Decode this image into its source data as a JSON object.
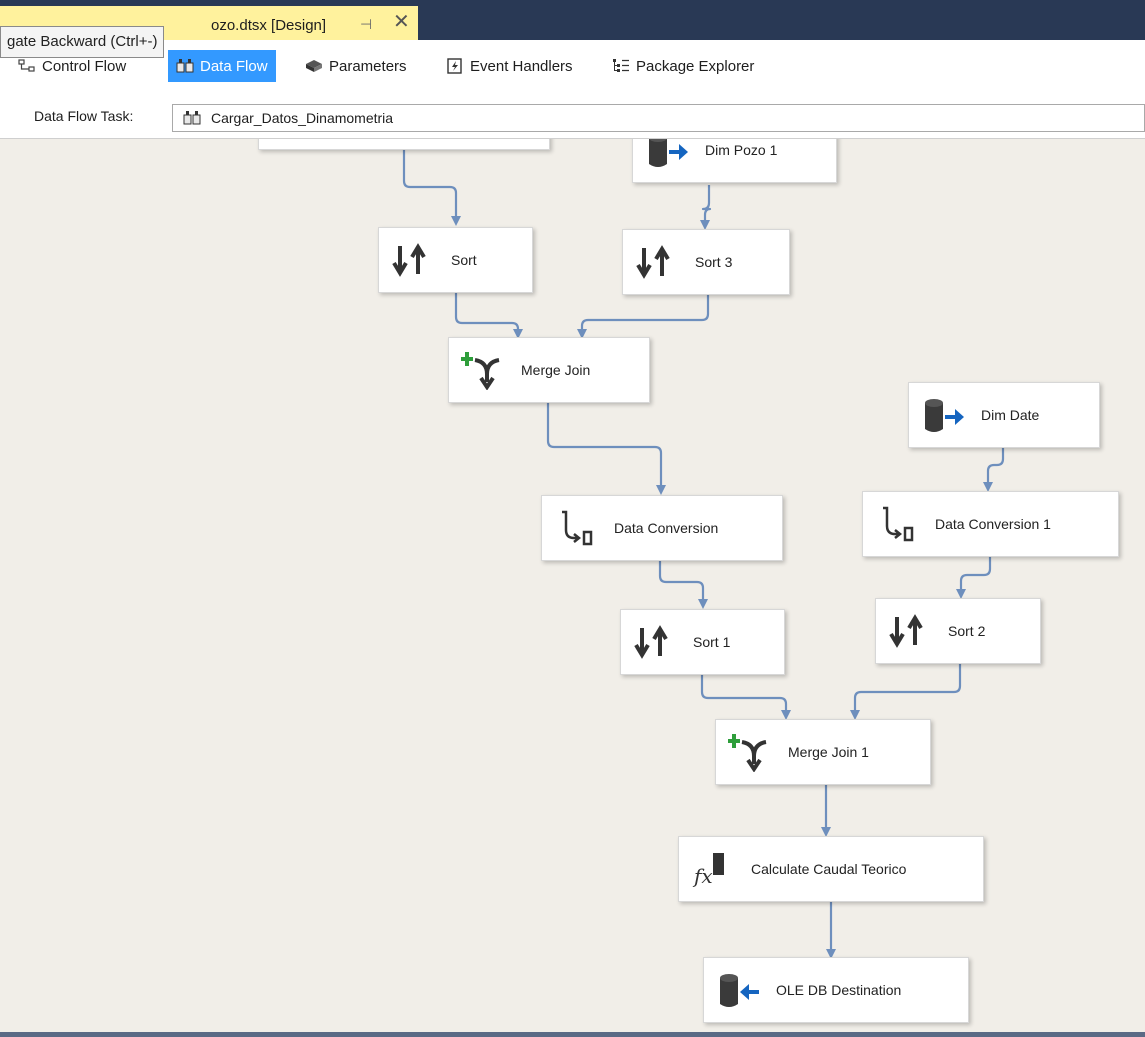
{
  "document_tab": {
    "title": "ozo.dtsx [Design]",
    "pin_glyph": "⊣",
    "close_glyph": "✕"
  },
  "tooltip": "gate Backward (Ctrl+-)",
  "designer_tabs": [
    {
      "label": "Control Flow",
      "icon": "control-flow-icon",
      "active": false
    },
    {
      "label": "Data Flow",
      "icon": "data-flow-icon",
      "active": true
    },
    {
      "label": "Parameters",
      "icon": "parameters-icon",
      "active": false
    },
    {
      "label": "Event Handlers",
      "icon": "event-handlers-icon",
      "active": false
    },
    {
      "label": "Package Explorer",
      "icon": "package-explorer-icon",
      "active": false
    }
  ],
  "task": {
    "label": "Data Flow Task:",
    "value": "Cargar_Datos_Dinamometria"
  },
  "nodes": [
    {
      "id": "dim-pozo-1",
      "label": "Dim Pozo 1",
      "icon": "source-icon"
    },
    {
      "id": "sort",
      "label": "Sort",
      "icon": "sort-icon"
    },
    {
      "id": "sort-3",
      "label": "Sort 3",
      "icon": "sort-icon"
    },
    {
      "id": "merge-join",
      "label": "Merge Join",
      "icon": "merge-join-icon"
    },
    {
      "id": "dim-date",
      "label": "Dim Date",
      "icon": "source-icon"
    },
    {
      "id": "data-conversion",
      "label": "Data Conversion",
      "icon": "data-conversion-icon"
    },
    {
      "id": "data-conversion-1",
      "label": "Data Conversion 1",
      "icon": "data-conversion-icon"
    },
    {
      "id": "sort-1",
      "label": "Sort 1",
      "icon": "sort-icon"
    },
    {
      "id": "sort-2",
      "label": "Sort 2",
      "icon": "sort-icon"
    },
    {
      "id": "merge-join-1",
      "label": "Merge Join 1",
      "icon": "merge-join-icon"
    },
    {
      "id": "calculate-caudal-teorico",
      "label": "Calculate Caudal Teorico",
      "icon": "derived-column-icon"
    },
    {
      "id": "ole-db-destination",
      "label": "OLE DB Destination",
      "icon": "destination-icon"
    }
  ],
  "colors": {
    "connector": "#6e8fbd",
    "canvas": "#f1eee8",
    "active_tab": "#3399ff",
    "doc_tab": "#fff29d",
    "titlebar": "#293955"
  }
}
